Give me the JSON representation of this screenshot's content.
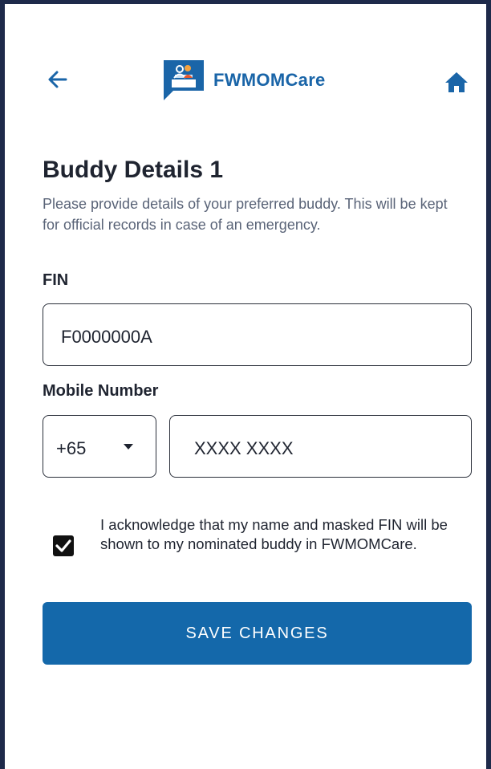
{
  "header": {
    "back_icon": "arrow-left-icon",
    "app_name": "FWMOMCare",
    "logo_icon": "fwmomcare-logo-icon",
    "home_icon": "home-icon"
  },
  "page": {
    "title": "Buddy Details 1",
    "description": "Please provide details of your preferred buddy. This will be kept for official records in case of an emergency."
  },
  "form": {
    "fin": {
      "label": "FIN",
      "value": "F0000000A"
    },
    "mobile": {
      "label": "Mobile Number",
      "country_code": "+65",
      "number": "XXXX XXXX"
    },
    "acknowledgement": {
      "checked": true,
      "text": "I acknowledge that my name and masked FIN will be shown to my nominated buddy in FWMOMCare."
    },
    "save_label": "SAVE CHANGES"
  },
  "colors": {
    "brand": "#1468aa",
    "text": "#1f2430",
    "muted": "#5a6478",
    "frame": "#1e2a4a"
  }
}
